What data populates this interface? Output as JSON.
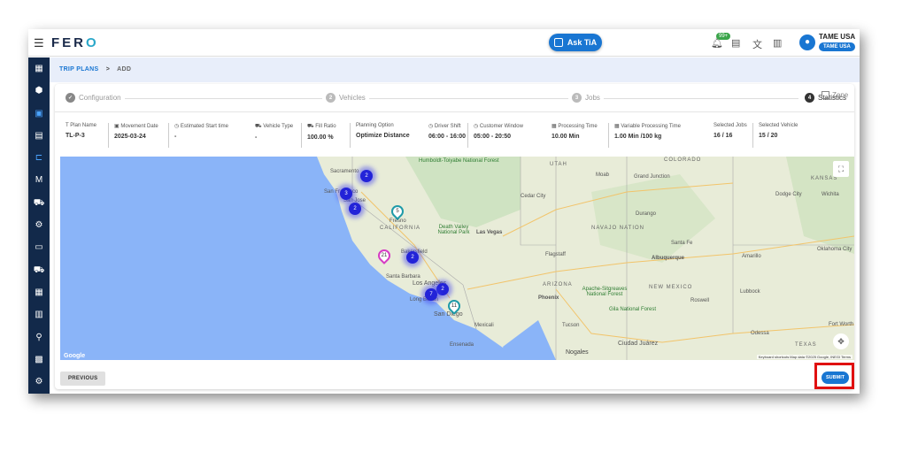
{
  "header": {
    "logo": "FER",
    "logo_accent": "O",
    "ask_button": "Ask TiA",
    "notification_badge": "99+",
    "user_name": "TAME USA",
    "org_pill": "TAME USA"
  },
  "sidebar": {
    "items": [
      "dashboard",
      "packages",
      "trip-plans",
      "orders",
      "routes",
      "mail",
      "vehicle",
      "settings-flow",
      "money",
      "truck",
      "calculator",
      "building",
      "network",
      "warehouse",
      "gear"
    ]
  },
  "breadcrumb": {
    "parent": "TRIP PLANS",
    "separator": ">",
    "current": "ADD"
  },
  "stepper": [
    {
      "num": "✓",
      "label": "Configuration"
    },
    {
      "num": "2",
      "label": "Vehicles"
    },
    {
      "num": "3",
      "label": "Jobs"
    },
    {
      "num": "4",
      "label": "Statistics"
    }
  ],
  "info": [
    {
      "icon": "T",
      "label": "Plan Name",
      "value": "TL-P-3"
    },
    {
      "icon": "▣",
      "label": "Movement Date",
      "value": "2025-03-24"
    },
    {
      "icon": "◷",
      "label": "Estimated Start time",
      "value": "-"
    },
    {
      "icon": "⛟",
      "label": "Vehicle Type",
      "value": "-"
    },
    {
      "icon": "⛟",
      "label": "Fill Ratio",
      "value": "100.00  %"
    },
    {
      "icon": "",
      "label": "Planning Option",
      "value": "Optimize Distance"
    },
    {
      "icon": "◷",
      "label": "Driver Shift",
      "value": "06:00 - 16:00"
    },
    {
      "icon": "◷",
      "label": "Customer Window",
      "value": "05:00 - 20:50"
    },
    {
      "icon": "▦",
      "label": "Processing Time",
      "value": "10.00  Min"
    },
    {
      "icon": "▦",
      "label": "Variable Processing Time",
      "value": "1.00  Min /100 kg"
    },
    {
      "icon": "",
      "label": "Selected Jobs",
      "value": "16 / 16"
    },
    {
      "icon": "",
      "label": "Selected Vehicle",
      "value": "15 / 20"
    }
  ],
  "zone_label": "Zone",
  "map": {
    "labels": [
      "Sacramento",
      "San Francisco",
      "San Jose",
      "Fresno",
      "CALIFORNIA",
      "Death Valley National Park",
      "Las Vegas",
      "Humboldt-Toiyabe National Forest",
      "UTAH",
      "Moab",
      "Cedar City",
      "COLORADO",
      "Grand Junction",
      "Durango",
      "Dodge City",
      "KANSAS",
      "Wichita",
      "NAVAJO NATION",
      "Flagstaff",
      "ARIZONA",
      "Phoenix",
      "Tucson",
      "NEW MEXICO",
      "Albuquerque",
      "Santa Fe",
      "Amarillo",
      "Oklahoma City",
      "Lubbock",
      "Roswell",
      "Bakersfield",
      "Santa Barbara",
      "Los Angeles",
      "Long Beach",
      "San Diego",
      "Mexicali",
      "Ensenada",
      "Nogales",
      "Ciudad Juárez",
      "Odessa",
      "TEXAS",
      "Fort Worth",
      "Apache-Sitgreaves National Forest",
      "Gila National Forest"
    ],
    "clusters": [
      "2",
      "3",
      "2",
      "2",
      "2",
      "7"
    ],
    "pins": [
      {
        "count": "5",
        "color": "#1e9aa8"
      },
      {
        "count": "21",
        "color": "#d63cc4"
      },
      {
        "count": "11",
        "color": "#1e9aa8"
      }
    ],
    "attribution": "Keyboard shortcuts   Map data ©2025 Google, INEGI   Terms",
    "google": "Google"
  },
  "footer": {
    "previous": "PREVIOUS",
    "submit": "SUBMIT"
  }
}
